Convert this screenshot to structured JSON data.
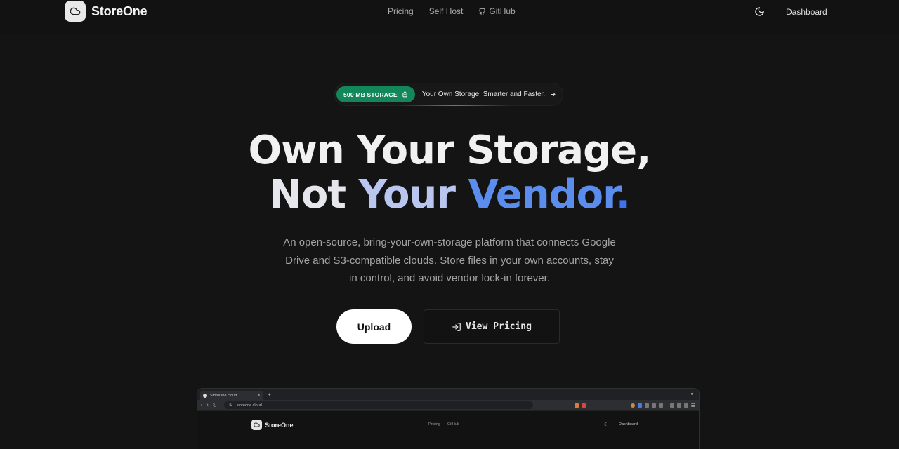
{
  "header": {
    "brand": "StoreOne",
    "nav": [
      {
        "label": "Pricing"
      },
      {
        "label": "Self Host"
      },
      {
        "label": "GitHub"
      }
    ],
    "theme_icon": "moon-icon",
    "dashboard": "Dashboard"
  },
  "badge": {
    "pill": "500 MB STORAGE",
    "text": "Your Own Storage, Smarter and Faster.",
    "accent": "#12875a"
  },
  "hero": {
    "line1": "Own Your Storage,",
    "line2_part1": "Not",
    "line2_part2": "Your",
    "line2_part3": "Vendor",
    "line2_part4": ".",
    "subtitle": "An open-source, bring-your-own-storage platform that connects Google Drive and S3-compatible clouds. Store files in your own accounts, stay in control, and avoid vendor lock-in forever.",
    "accent": "#3d74ee"
  },
  "actions": {
    "upload": "Upload",
    "pricing": "View Pricing"
  },
  "preview": {
    "tab_title": "StoreOne.cloud",
    "url": "storeone.cloud",
    "brand": "StoreOne",
    "nav": [
      "Pricing",
      "GitHub"
    ],
    "dashboard": "Dashboard"
  }
}
